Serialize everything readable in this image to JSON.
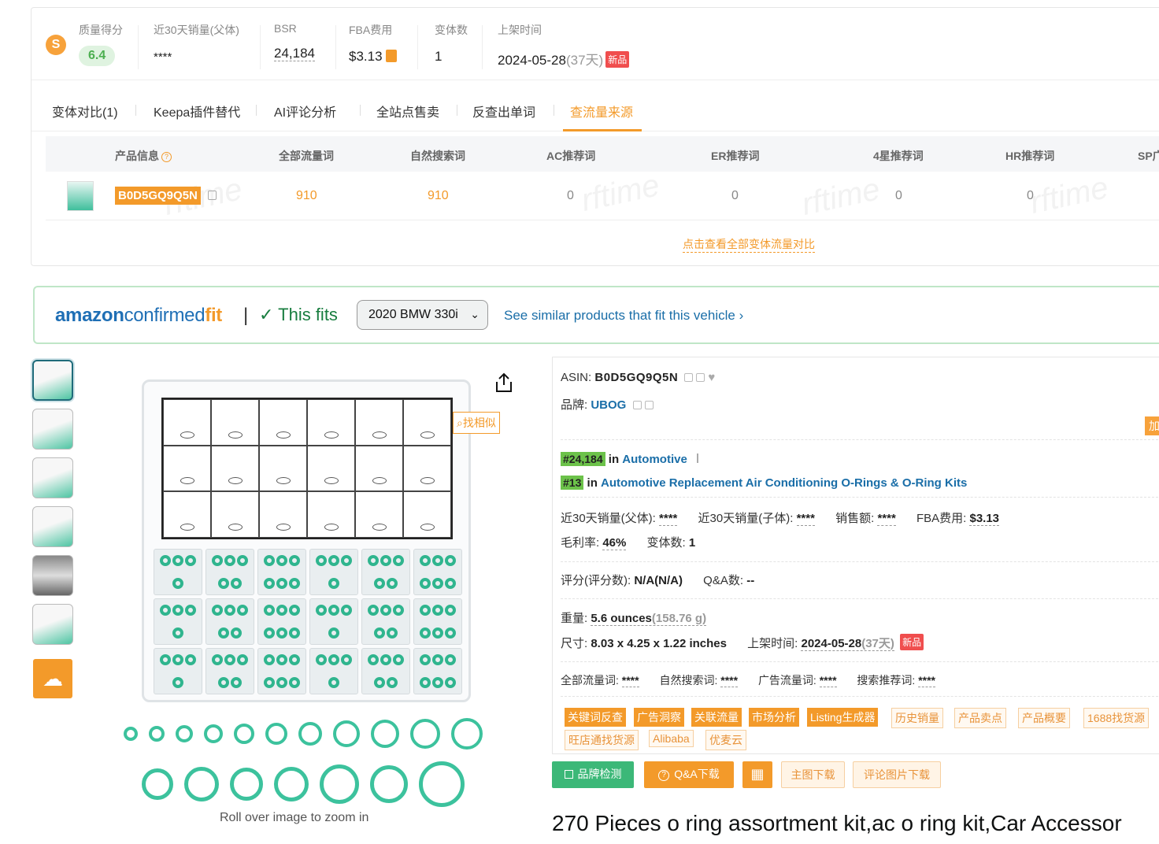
{
  "stats": {
    "quality_label": "质量得分",
    "quality_value": "6.4",
    "sales30_label": "近30天销量(父体)",
    "sales30_value": "****",
    "bsr_label": "BSR",
    "bsr_value": "24,184",
    "fba_label": "FBA费用",
    "fba_value": "$3.13",
    "variants_label": "变体数",
    "variants_value": "1",
    "listed_label": "上架时间",
    "listed_date": "2024-05-28",
    "listed_days": "(37天)",
    "new_badge": "新品"
  },
  "tabs": [
    "变体对比(1)",
    "Keepa插件替代",
    "AI评论分析",
    "全站点售卖",
    "反查出单词",
    "查流量来源"
  ],
  "traffic_table": {
    "headers": [
      "产品信息",
      "全部流量词",
      "自然搜索词",
      "AC推荐词",
      "ER推荐词",
      "4星推荐词",
      "HR推荐词",
      "SP广"
    ],
    "row": {
      "asin": "B0D5GQ9Q5N",
      "all": "910",
      "organic": "910",
      "ac": "0",
      "er": "0",
      "four_star": "0",
      "hr": "0"
    },
    "watermark": "rftime",
    "view_all": "点击查看全部变体流量对比"
  },
  "fit": {
    "logo_a": "amazon",
    "logo_b": "confirmed",
    "logo_c": "fit",
    "pipe": "|",
    "check": "✓ This fits",
    "vehicle": "2020 BMW 330i",
    "similar": "See similar products that fit this vehicle ›"
  },
  "gallery": {
    "find_similar": "找相似",
    "zoom_hint": "Roll over image to zoom in"
  },
  "info": {
    "asin_label": "ASIN:",
    "asin_value": "B0D5GQ9Q5N",
    "brand_label": "品牌:",
    "brand_value": "UBOG",
    "add_label": "加入",
    "rank1_badge": "#24,184",
    "rank1_in": "in",
    "rank1_cat": "Automotive",
    "rank2_badge": "#13",
    "rank2_in": "in",
    "rank2_cat": "Automotive Replacement Air Conditioning O-Rings & O-Ring Kits",
    "parent_sales_label": "近30天销量(父体):",
    "parent_sales_value": "****",
    "child_sales_label": "近30天销量(子体):",
    "child_sales_value": "****",
    "revenue_label": "销售额:",
    "revenue_value": "****",
    "fba_label": "FBA费用:",
    "fba_value": "$3.13",
    "margin_label": "毛利率:",
    "margin_value": "46%",
    "variants_label": "变体数:",
    "variants_value": "1",
    "rating_label": "评分(评分数):",
    "rating_value": "N/A(N/A)",
    "qa_label": "Q&A数:",
    "qa_value": "--",
    "weight_label": "重量:",
    "weight_value": "5.6 ounces",
    "weight_g": "(158.76 g)",
    "size_label": "尺寸:",
    "size_value": "8.03 x 4.25 x 1.22 inches",
    "listed_label": "上架时间:",
    "listed_date": "2024-05-28",
    "listed_days": "(37天)",
    "new_badge": "新品",
    "all_kw_label": "全部流量词:",
    "all_kw_value": "****",
    "organic_kw_label": "自然搜索词:",
    "organic_kw_value": "****",
    "ad_kw_label": "广告流量词:",
    "ad_kw_value": "****",
    "rec_kw_label": "搜索推荐词:",
    "rec_kw_value": "****"
  },
  "tools_row1": [
    "关键词反查",
    "广告洞察",
    "关联流量",
    "市场分析",
    "Listing生成器",
    "历史销量",
    "产品卖点",
    "产品概要",
    "1688找货源"
  ],
  "tools_row2": [
    "旺店通找货源",
    "Alibaba",
    "优麦云"
  ],
  "actions": {
    "brand_check": "品牌检测",
    "qa_download": "Q&A下载",
    "main_img_download": "主图下载",
    "review_img_download": "评论图片下载"
  },
  "product_title": "270 Pieces o ring assortment kit,ac o ring kit,Car Accessor"
}
